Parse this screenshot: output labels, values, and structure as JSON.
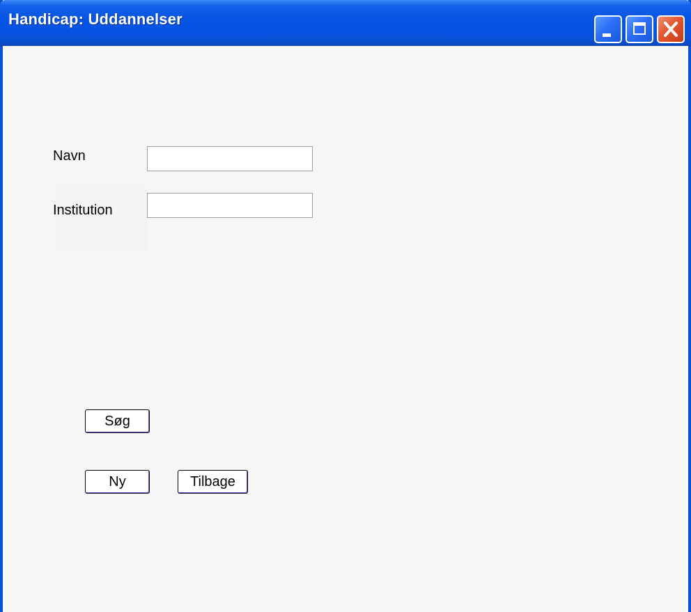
{
  "window": {
    "title": "Handicap: Uddannelser"
  },
  "form": {
    "navn_label": "Navn",
    "navn_value": "",
    "institution_label": "Institution",
    "institution_value": ""
  },
  "buttons": {
    "search_label": "Søg",
    "new_label": "Ny",
    "back_label": "Tilbage"
  },
  "colors": {
    "titlebar": "#0554e4",
    "frame": "#0a4fd8",
    "close_button": "#e3572f",
    "background": "#f6f6f6"
  }
}
